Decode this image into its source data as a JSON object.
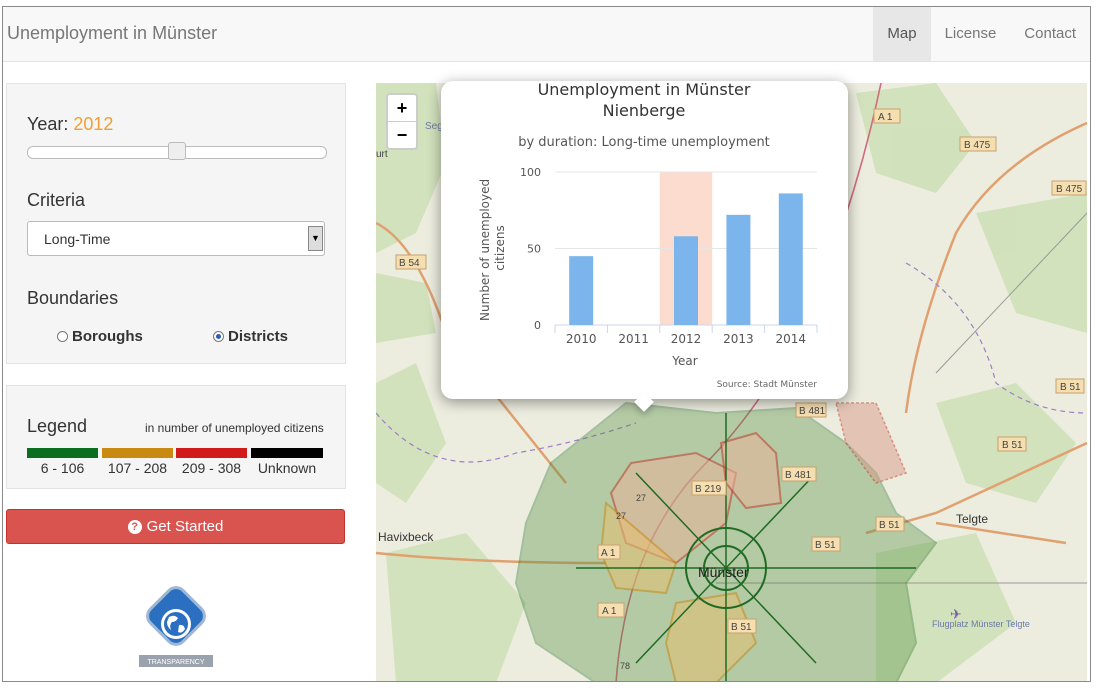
{
  "navbar": {
    "brand": "Unemployment in Münster",
    "items": [
      "Map",
      "License",
      "Contact"
    ]
  },
  "controls": {
    "year_label": "Year: ",
    "year_value": "2012",
    "year_slider_fraction": 0.5,
    "criteria_label": "Criteria",
    "criteria_selected": "Long-Time",
    "boundaries_label": "Boundaries",
    "boundary_options": [
      "Boroughs",
      "Districts"
    ],
    "boundary_selected": "Districts"
  },
  "legend": {
    "title": "Legend",
    "subtitle": "in number of unemployed citizens",
    "items": [
      {
        "label": "6 - 106",
        "color": "#0a6e1e"
      },
      {
        "label": "107 - 208",
        "color": "#c98a12"
      },
      {
        "label": "209 - 308",
        "color": "#d11a1a"
      },
      {
        "label": "Unknown",
        "color": "#000000"
      }
    ]
  },
  "button": {
    "label": "Get Started",
    "icon": "question-circle-icon"
  },
  "logo": {
    "text": "TRANSPARENCY",
    "icon": "globe-icon"
  },
  "map": {
    "zoom_in": "+",
    "zoom_out": "−",
    "labels": [
      "Seg",
      "A 1",
      "B 475",
      "B 475",
      "urt",
      "B 54",
      "B 51",
      "B 51",
      "B 481",
      "B 481",
      "B 219",
      "B 51",
      "B 51",
      "Telgte",
      "Havixbeck",
      "Münster",
      "A 1",
      "A 1",
      "B 51",
      "Flugplatz Münster Telgte",
      "27",
      "27",
      "78"
    ]
  },
  "chart_data": {
    "type": "bar",
    "title": "Unemployment in Münster",
    "subtitle_line": "Nienberge",
    "subtitle": "by duration: Long-time unemployment",
    "xlabel": "Year",
    "ylabel": "Number of unemployed citizens",
    "categories": [
      "2010",
      "2011",
      "2012",
      "2013",
      "2014"
    ],
    "values": [
      45,
      null,
      58,
      72,
      86
    ],
    "highlighted_category": "2012",
    "ylim": [
      0,
      100
    ],
    "yticks": [
      0,
      50,
      100
    ],
    "source": "Source: Stadt Münster",
    "bar_color": "#7cb5ec",
    "highlight_color": "#fcdcce"
  }
}
